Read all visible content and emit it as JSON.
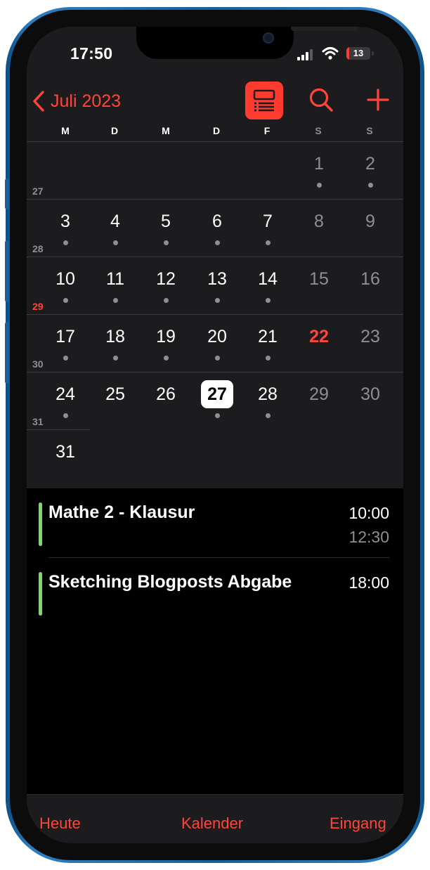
{
  "status_bar": {
    "time": "17:50",
    "battery_level": "13"
  },
  "nav": {
    "back_label": "Juli 2023",
    "icons": [
      "chevron-left-icon",
      "list-view-icon",
      "search-icon",
      "plus-icon"
    ]
  },
  "weekdays": [
    "M",
    "D",
    "M",
    "D",
    "F",
    "S",
    "S"
  ],
  "weeks": [
    {
      "week": "",
      "days": [
        "",
        "",
        "",
        "",
        "",
        "1",
        "2"
      ],
      "dots": [
        false,
        false,
        false,
        false,
        false,
        true,
        true
      ]
    },
    {
      "week": "27",
      "days": [
        "3",
        "4",
        "5",
        "6",
        "7",
        "8",
        "9"
      ],
      "dots": [
        true,
        true,
        true,
        true,
        true,
        false,
        false
      ]
    },
    {
      "week": "28",
      "days": [
        "10",
        "11",
        "12",
        "13",
        "14",
        "15",
        "16"
      ],
      "dots": [
        true,
        true,
        true,
        true,
        true,
        false,
        false
      ]
    },
    {
      "week": "29",
      "days": [
        "17",
        "18",
        "19",
        "20",
        "21",
        "22",
        "23"
      ],
      "dots": [
        true,
        true,
        true,
        true,
        true,
        false,
        false
      ]
    },
    {
      "week": "30",
      "days": [
        "24",
        "25",
        "26",
        "27",
        "28",
        "29",
        "30"
      ],
      "dots": [
        true,
        false,
        false,
        true,
        true,
        false,
        false
      ]
    },
    {
      "week": "31",
      "days": [
        "31",
        "",
        "",
        "",
        "",
        "",
        ""
      ],
      "dots": [
        false,
        false,
        false,
        false,
        false,
        false,
        false
      ]
    }
  ],
  "today": "22",
  "selected": "27",
  "current_week": "29",
  "events": [
    {
      "title": "Mathe 2 - Klausur",
      "start": "10:00",
      "end": "12:30"
    },
    {
      "title": "Sketching Blogposts Abgabe",
      "start": "18:00",
      "end": ""
    }
  ],
  "tabs": {
    "today": "Heute",
    "calendars": "Kalender",
    "inbox": "Eingang"
  },
  "colors": {
    "accent": "#ff453a",
    "background": "#1c1c1e",
    "event_bar": "#7ed96f",
    "weekend_text": "#8e8e93",
    "weekday_text": "#ffffff",
    "frame": "#1a5f99"
  }
}
